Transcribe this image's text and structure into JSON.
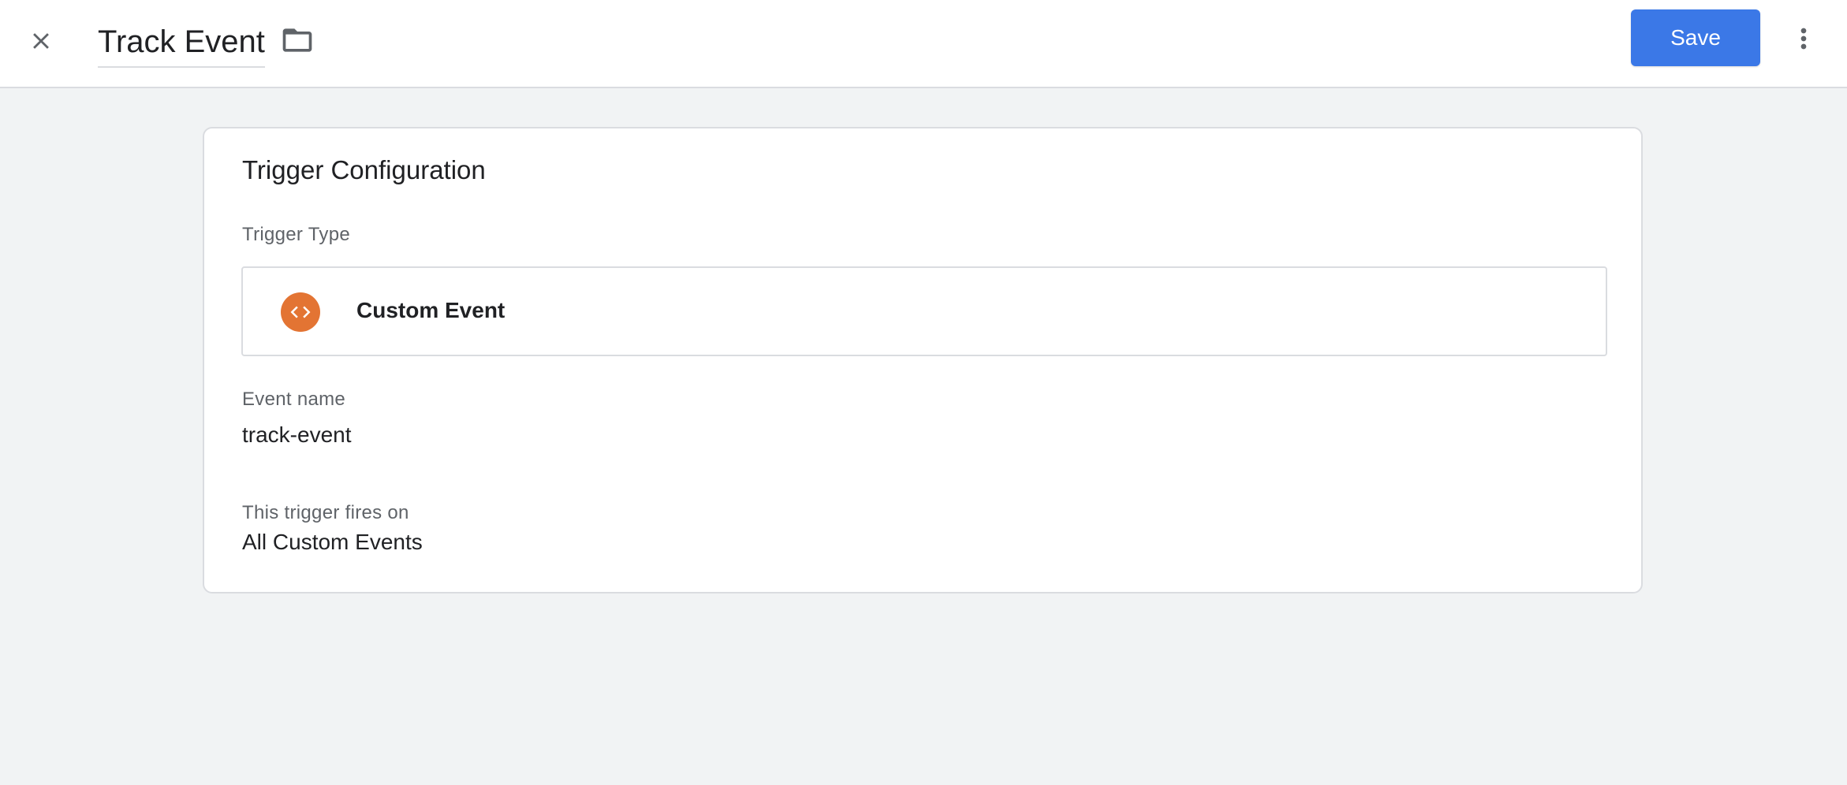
{
  "header": {
    "title": "Track Event",
    "close_icon": "close-icon",
    "folder_icon": "folder-icon",
    "save_label": "Save",
    "more_icon": "more-vert-icon"
  },
  "card": {
    "title": "Trigger Configuration",
    "trigger_type_label": "Trigger Type",
    "trigger_type": {
      "name": "Custom Event",
      "icon": "code-icon",
      "icon_color": "#e37433"
    },
    "event_name_label": "Event name",
    "event_name_value": "track-event",
    "fires_on_label": "This trigger fires on",
    "fires_on_value": "All Custom Events"
  },
  "colors": {
    "accent": "#3b78e7",
    "background": "#f1f3f4"
  }
}
